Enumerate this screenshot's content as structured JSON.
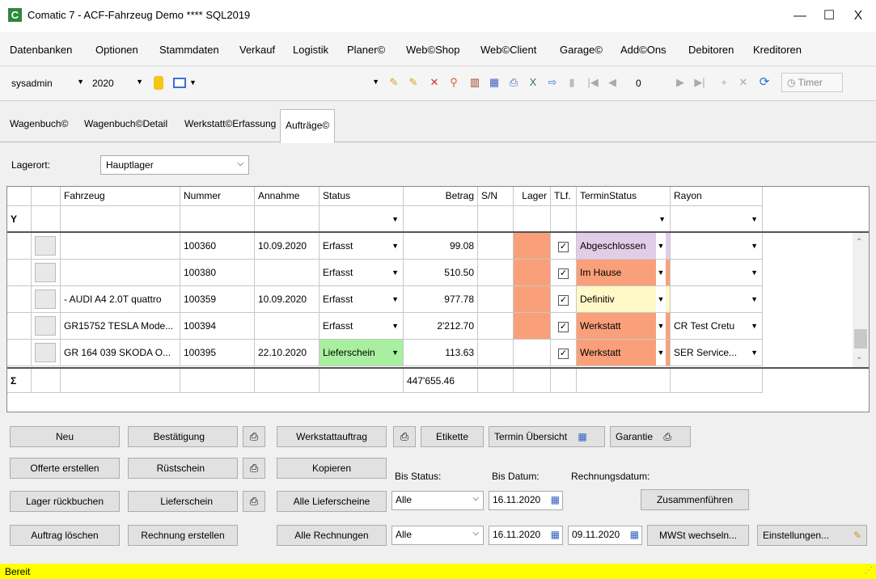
{
  "window": {
    "title": "Comatic 7 - ACF-Fahrzeug Demo **** SQL2019",
    "icon_letter": "C",
    "minimize": "—",
    "maximize": "☐",
    "close": "X"
  },
  "menu": [
    "Datenbanken",
    "Optionen",
    "Stammdaten",
    "Verkauf",
    "Logistik",
    "Planer©",
    "Web©Shop",
    "Web©Client",
    "Garage©",
    "Add©Ons",
    "Debitoren",
    "Kreditoren"
  ],
  "toolbar": {
    "user": "sysadmin",
    "year": "2020",
    "record_count": "0",
    "timer_label": "Timer"
  },
  "tabs": [
    "Wagenbuch©",
    "Wagenbuch©Detail",
    "Werkstatt©Erfassung",
    "Aufträge©"
  ],
  "filter": {
    "lagerort_label": "Lagerort:",
    "lagerort_value": "Hauptlager"
  },
  "grid": {
    "columns": [
      "Fahrzeug",
      "Nummer",
      "Annahme",
      "Status",
      "Betrag",
      "S/N",
      "Lager",
      "TLf.",
      "TerminStatus",
      "Rayon"
    ],
    "rows": [
      {
        "fahrzeug": "",
        "nummer": "100360",
        "annahme": "10.09.2020",
        "status": "Erfasst",
        "betrag": "99.08",
        "terminstatus": "Abgeschlossen",
        "rayon": ""
      },
      {
        "fahrzeug": "",
        "nummer": "100380",
        "annahme": "",
        "status": "Erfasst",
        "betrag": "510.50",
        "terminstatus": "Im Hause",
        "rayon": ""
      },
      {
        "fahrzeug": "- AUDI A4 2.0T quattro",
        "nummer": "100359",
        "annahme": "10.09.2020",
        "status": "Erfasst",
        "betrag": "977.78",
        "terminstatus": "Definitiv",
        "rayon": ""
      },
      {
        "fahrzeug": "GR15752 TESLA Mode...",
        "nummer": "100394",
        "annahme": "",
        "status": "Erfasst",
        "betrag": "2'212.70",
        "terminstatus": "Werkstatt",
        "rayon": "CR Test Cretu"
      },
      {
        "fahrzeug": "GR 164 039 SKODA O...",
        "nummer": "100395",
        "annahme": "22.10.2020",
        "status": "Lieferschein",
        "betrag": "113.63",
        "terminstatus": "Werkstatt",
        "rayon": "SER Service..."
      }
    ],
    "sum_symbol": "Σ",
    "filter_symbol": "Y",
    "total": "447'655.46",
    "colors": {
      "lager": "#f9a07a",
      "abgeschlossen": "#e3cce8",
      "im_hause": "#f9a07a",
      "definitiv": "#fff9c8",
      "werkstatt": "#f9a07a",
      "lieferschein": "#a8f0a0"
    }
  },
  "buttons": {
    "neu": "Neu",
    "bestaetigung": "Bestätigung",
    "werkstattauftrag": "Werkstattauftrag",
    "etikette": "Etikette",
    "termin_uebersicht": "Termin Übersicht",
    "garantie": "Garantie",
    "offerte": "Offerte erstellen",
    "ruestschein": "Rüstschein",
    "kopieren": "Kopieren",
    "lager_rueckbuchen": "Lager rückbuchen",
    "lieferschein": "Lieferschein",
    "alle_lieferscheine": "Alle Lieferscheine",
    "zusammenfuehren": "Zusammenführen",
    "auftrag_loeschen": "Auftrag löschen",
    "rechnung_erstellen": "Rechnung erstellen",
    "alle_rechnungen": "Alle Rechnungen",
    "mwst": "MWSt wechseln...",
    "einstellungen": "Einstellungen..."
  },
  "labels": {
    "bis_status": "Bis Status:",
    "bis_datum": "Bis Datum:",
    "rechnungsdatum": "Rechnungsdatum:"
  },
  "fields": {
    "status1": "Alle",
    "status2": "Alle",
    "datum1": "16.11.2020",
    "datum2": "16.11.2020",
    "rechnungsdatum": "09.11.2020"
  },
  "status": "Bereit"
}
